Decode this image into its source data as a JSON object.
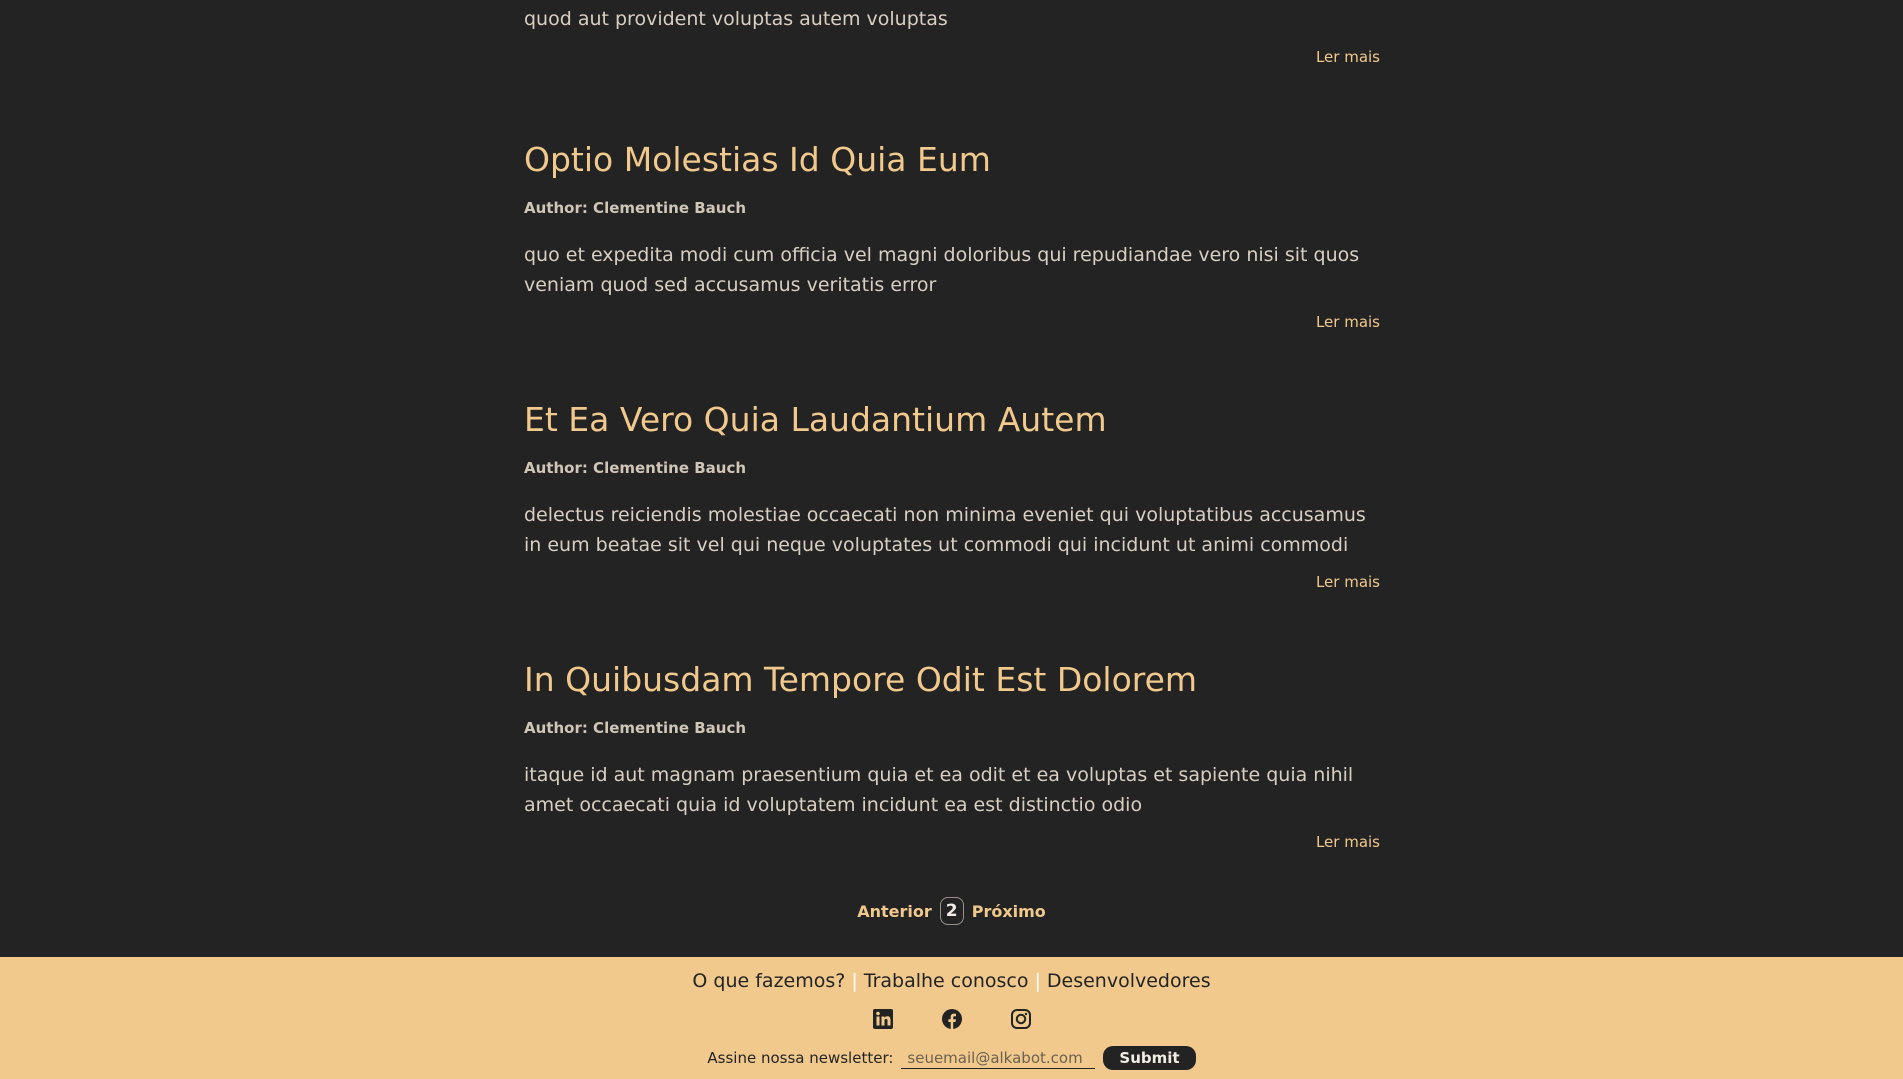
{
  "posts": [
    {
      "title": "",
      "author": "",
      "body": "quod aut provident voluptas autem voluptas",
      "read_more": "Ler mais"
    },
    {
      "title": "Optio Molestias Id Quia Eum",
      "author": "Author: Clementine Bauch",
      "body": "quo et expedita modi cum officia vel magni doloribus qui repudiandae vero nisi sit quos veniam quod sed accusamus veritatis error",
      "read_more": "Ler mais"
    },
    {
      "title": "Et Ea Vero Quia Laudantium Autem",
      "author": "Author: Clementine Bauch",
      "body": "delectus reiciendis molestiae occaecati non minima eveniet qui voluptatibus accusamus in eum beatae sit vel qui neque voluptates ut commodi qui incidunt ut animi commodi",
      "read_more": "Ler mais"
    },
    {
      "title": "In Quibusdam Tempore Odit Est Dolorem",
      "author": "Author: Clementine Bauch",
      "body": "itaque id aut magnam praesentium quia et ea odit et ea voluptas et sapiente quia nihil amet occaecati quia id voluptatem incidunt ea est distinctio odio",
      "read_more": "Ler mais"
    }
  ],
  "pagination": {
    "prev_label": "Anterior",
    "current_page": "2",
    "next_label": "Próximo"
  },
  "footer": {
    "links": [
      "O que fazemos?",
      "Trabalhe conosco",
      "Desenvolvedores"
    ],
    "separator": "|",
    "social_icons": [
      "linkedin-icon",
      "facebook-icon",
      "instagram-icon"
    ],
    "newsletter_label": "Assine nossa newsletter:",
    "newsletter_placeholder": "seuemail@alkabot.com",
    "submit_label": "Submit"
  },
  "colors": {
    "background": "#232323",
    "accent": "#f1c98d",
    "text": "#d8cfc2"
  }
}
